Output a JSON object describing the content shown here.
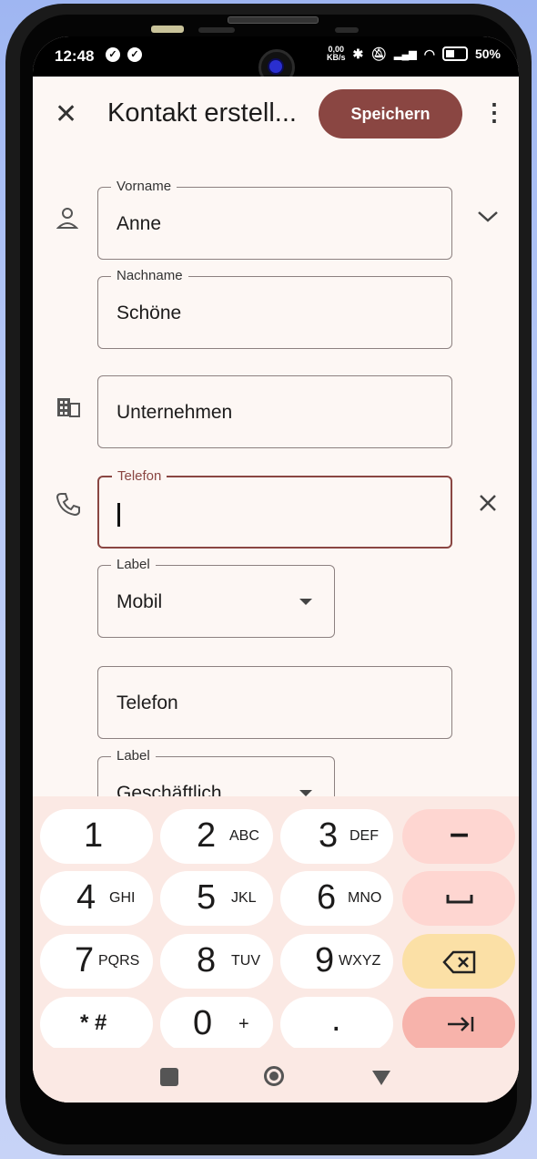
{
  "status": {
    "time": "12:48",
    "kbs": "0,00\nKB/s",
    "battery": "50%"
  },
  "appbar": {
    "title": "Kontakt erstell...",
    "save_label": "Speichern"
  },
  "fields": {
    "vorname": {
      "label": "Vorname",
      "value": "Anne"
    },
    "nachname": {
      "label": "Nachname",
      "value": "Schöne"
    },
    "unternehmen": {
      "placeholder": "Unternehmen"
    },
    "telefon1": {
      "label": "Telefon",
      "value": ""
    },
    "label1": {
      "label": "Label",
      "value": "Mobil"
    },
    "telefon2": {
      "placeholder": "Telefon"
    },
    "label2": {
      "label": "Label",
      "value": "Geschäftlich"
    }
  },
  "keyboard": {
    "k1": {
      "digit": "1",
      "letters": ""
    },
    "k2": {
      "digit": "2",
      "letters": "ABC"
    },
    "k3": {
      "digit": "3",
      "letters": "DEF"
    },
    "k4": {
      "digit": "4",
      "letters": "GHI"
    },
    "k5": {
      "digit": "5",
      "letters": "JKL"
    },
    "k6": {
      "digit": "6",
      "letters": "MNO"
    },
    "k7": {
      "digit": "7",
      "letters": "PQRS"
    },
    "k8": {
      "digit": "8",
      "letters": "TUV"
    },
    "k9": {
      "digit": "9",
      "letters": "WXYZ"
    },
    "kstar": {
      "digit": "* #",
      "letters": ""
    },
    "k0": {
      "digit": "0",
      "letters": "+"
    },
    "kdot": {
      "digit": ".",
      "letters": ""
    }
  },
  "colors": {
    "accent": "#8a4642",
    "keyboard_bg": "#fbe9e4",
    "side_key": "#fed6d1",
    "delete_key": "#fbe0a6",
    "next_key": "#f7b3ab"
  }
}
